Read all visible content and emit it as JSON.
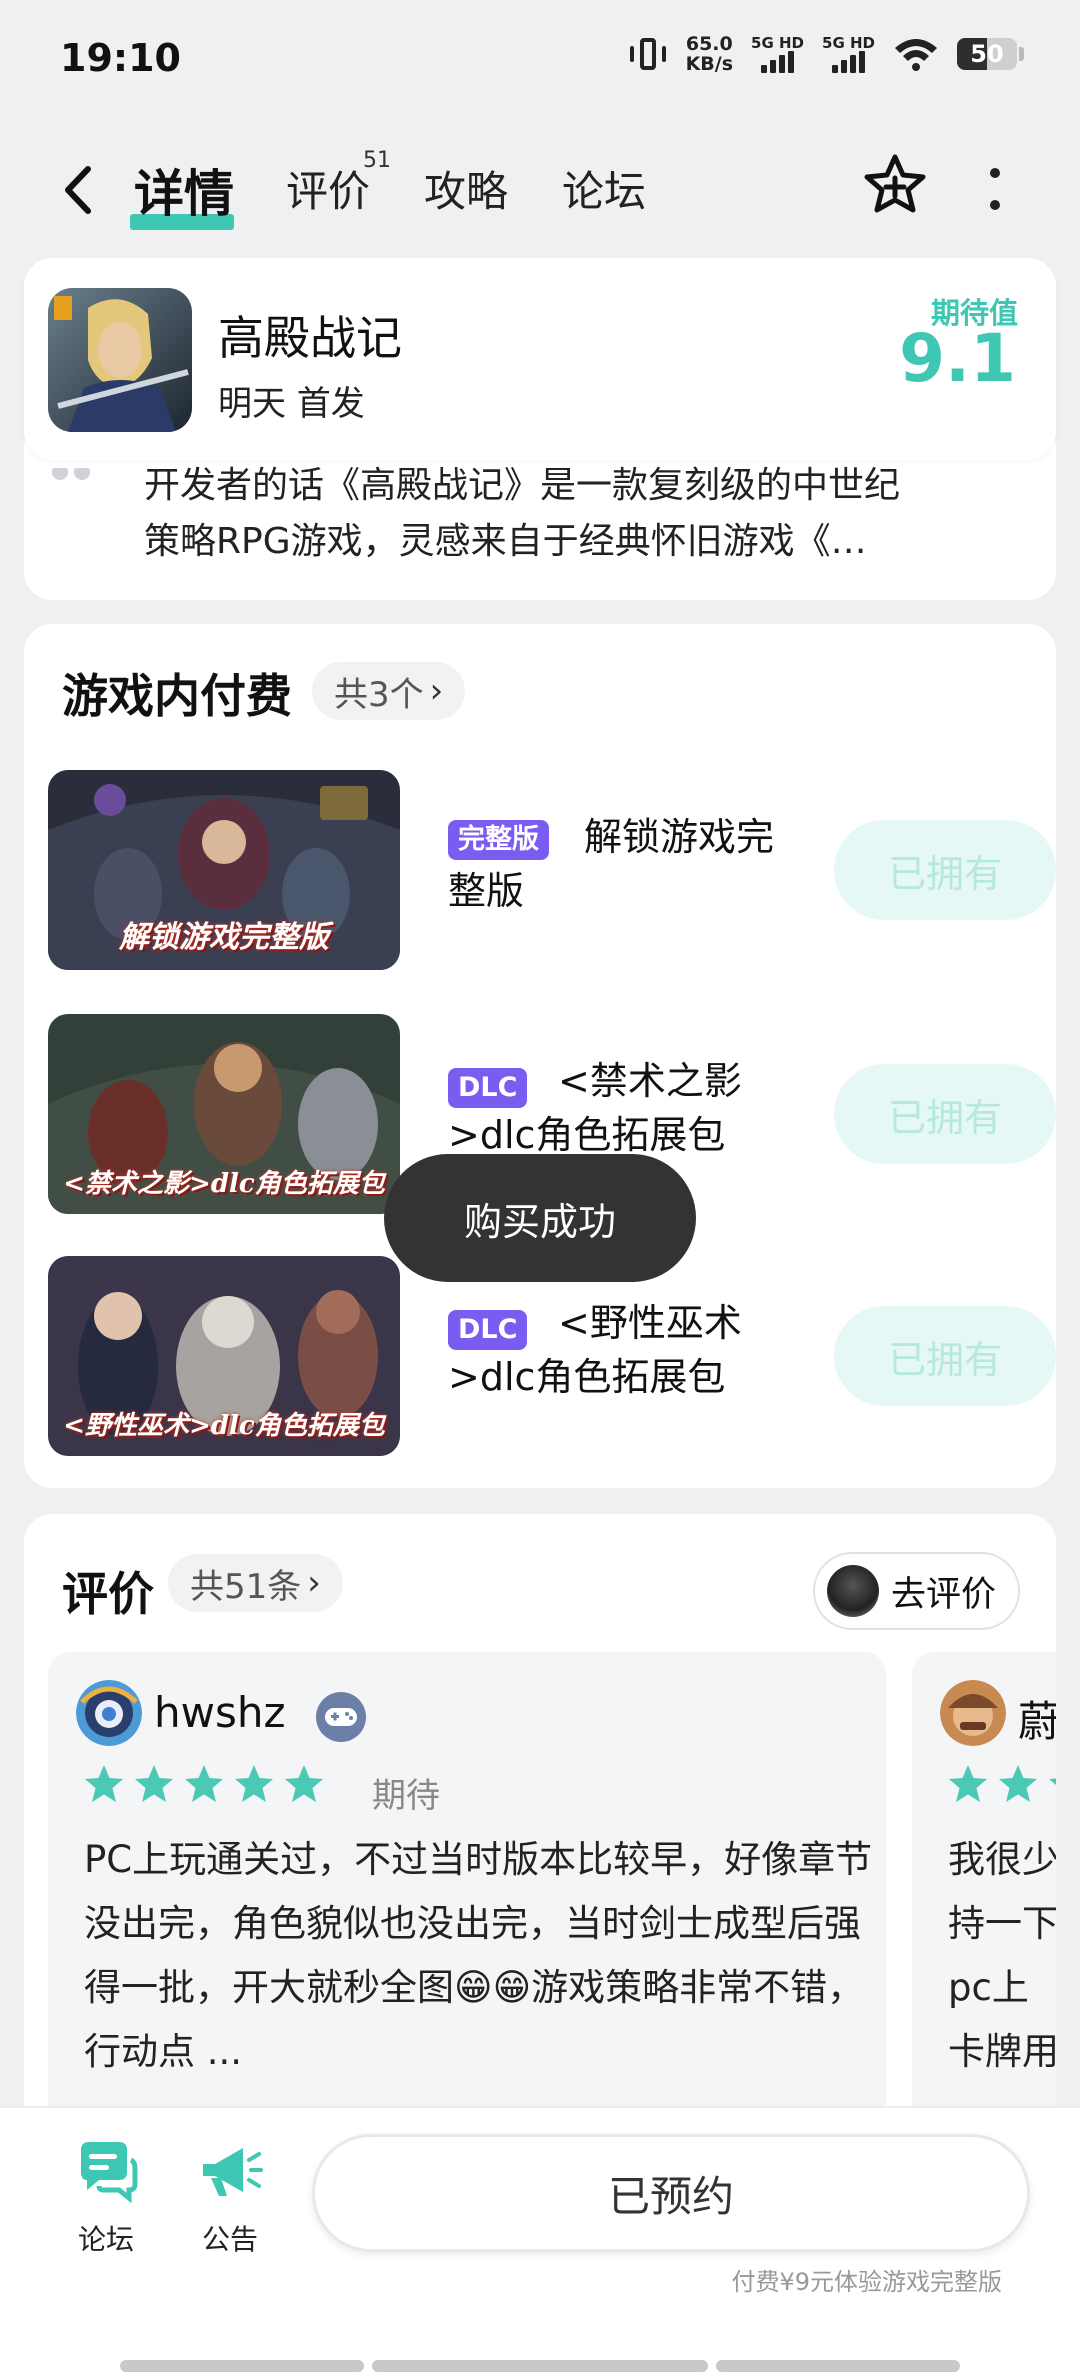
{
  "status_bar": {
    "time": "19:10",
    "net_speed_value": "65.0",
    "net_speed_unit": "KB/s",
    "sim1": "5G HD",
    "sim2": "5G HD",
    "battery": "50",
    "battery_level": 0.5
  },
  "tabs": [
    {
      "label": "详情",
      "active": true
    },
    {
      "label": "评价",
      "badge": "51"
    },
    {
      "label": "攻略"
    },
    {
      "label": "论坛"
    }
  ],
  "game": {
    "name": "高殿战记",
    "release": "明天 首发",
    "expect_label": "期待值",
    "expect_score": "9.1"
  },
  "description": {
    "line1": "开发者的话《高殿战记》是一款复刻级的中世纪",
    "line2": "策略RPG游戏，灵感来自于经典怀旧游戏《…"
  },
  "iap": {
    "title": "游戏内付费",
    "count": "共3个",
    "items": [
      {
        "tag": "完整版",
        "title": "解锁游戏完整版",
        "thumb_caption": "解锁游戏完整版",
        "button": "已拥有"
      },
      {
        "tag": "DLC",
        "title": "<禁术之影>dlc角色拓展包",
        "thumb_caption": "<禁术之影>dlc角色拓展包",
        "button": "已拥有"
      },
      {
        "tag": "DLC",
        "title": "<野性巫术>dlc角色拓展包",
        "thumb_caption": "<野性巫术>dlc角色拓展包",
        "button": "已拥有"
      }
    ]
  },
  "toast": "购买成功",
  "reviews": {
    "title": "评价",
    "count": "共51条",
    "write_label": "去评价",
    "items": [
      {
        "user": "hwshz",
        "rating": 5,
        "status": "期待",
        "text": "PC上玩通关过，不过当时版本比较早，好像章节没出完，角色貌似也没出完，当时剑士成型后强得一批，开大就秒全图😁😁游戏策略非常不错，行动点 ..."
      },
      {
        "user": "蔚",
        "rating": 5,
        "text_lines": [
          "我很少",
          "持一下",
          "pc上",
          "卡牌用"
        ]
      }
    ]
  },
  "bottom": {
    "forum_label": "论坛",
    "notice_label": "公告",
    "reserve_label": "已预约",
    "promo_note": "付费¥9元体验游戏完整版"
  },
  "colors": {
    "accent": "#3ec7b2",
    "tag_purple": "#7a5cf0",
    "owned_bg": "#e6f8f5",
    "star": "#4cc9b4"
  }
}
